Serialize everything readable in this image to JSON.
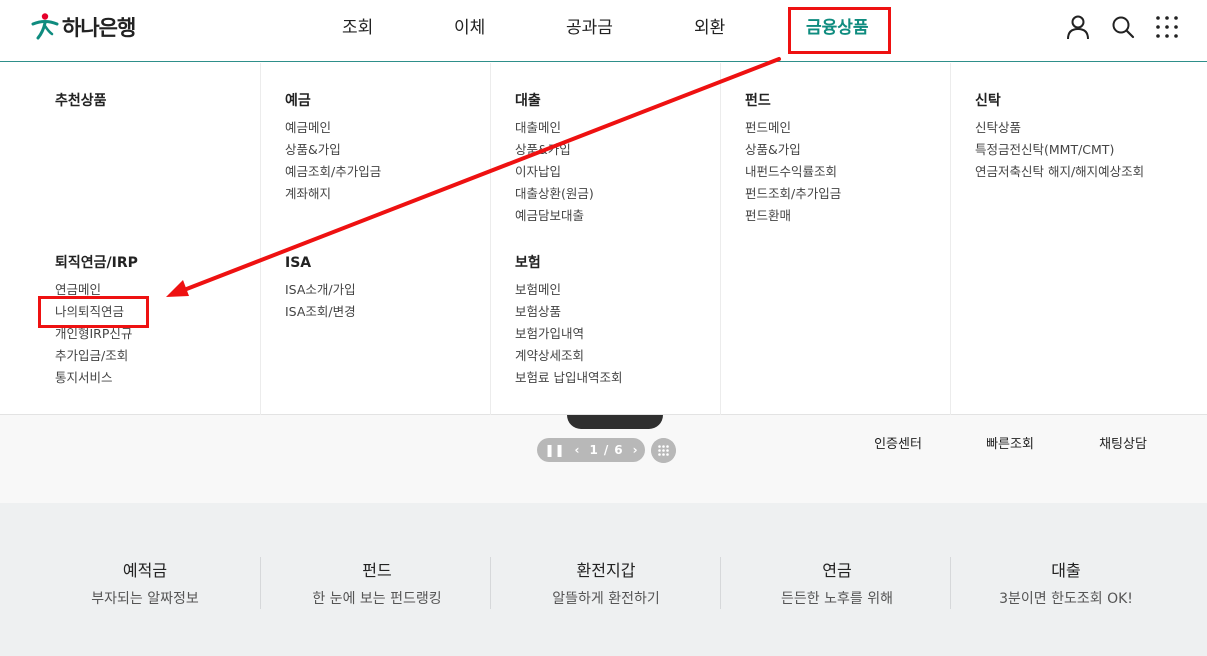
{
  "brand": {
    "name": "하나은행",
    "accent": "#0f8c7f",
    "logo_red": "#e5002b"
  },
  "gnb": {
    "items": [
      "조회",
      "이체",
      "공과금",
      "외환",
      "금융상품"
    ],
    "active_index": 4
  },
  "utilities": [
    "user-icon",
    "search-icon",
    "all-menu-icon"
  ],
  "mega_menu": {
    "recommended": {
      "title": "추천상품",
      "links": []
    },
    "deposit": {
      "title": "예금",
      "links": [
        "예금메인",
        "상품&가입",
        "예금조회/추가입금",
        "계좌해지"
      ]
    },
    "loan": {
      "title": "대출",
      "links": [
        "대출메인",
        "상품&가입",
        "이자납입",
        "대출상환(원금)",
        "예금담보대출"
      ]
    },
    "fund": {
      "title": "펀드",
      "links": [
        "펀드메인",
        "상품&가입",
        "내펀드수익률조회",
        "펀드조회/추가입금",
        "펀드환매"
      ]
    },
    "trust": {
      "title": "신탁",
      "links": [
        "신탁상품",
        "특정금전신탁(MMT/CMT)",
        "연금저축신탁 해지/해지예상조회"
      ]
    },
    "pension": {
      "title": "퇴직연금/IRP",
      "links": [
        "연금메인",
        "나의퇴직연금",
        "개인형IRP신규",
        "추가입금/조회",
        "통지서비스"
      ]
    },
    "isa": {
      "title": "ISA",
      "links": [
        "ISA소개/가입",
        "ISA조회/변경"
      ]
    },
    "insurance": {
      "title": "보험",
      "links": [
        "보험메인",
        "보험상품",
        "보험가입내역",
        "계약상세조회",
        "보험료 납입내역조회"
      ]
    }
  },
  "hero": {
    "pager": {
      "current": "1",
      "separator": "/",
      "total": "6"
    },
    "quick": [
      "인증센터",
      "빠른조회",
      "채팅상담"
    ]
  },
  "band": [
    {
      "title": "예적금",
      "sub": "부자되는 알짜정보"
    },
    {
      "title": "펀드",
      "sub": "한 눈에 보는 펀드랭킹"
    },
    {
      "title": "환전지갑",
      "sub": "알뜰하게 환전하기"
    },
    {
      "title": "연금",
      "sub": "든든한 노후를 위해"
    },
    {
      "title": "대출",
      "sub": "3분이면 한도조회 OK!"
    }
  ],
  "annotation_color": "#ee1111"
}
